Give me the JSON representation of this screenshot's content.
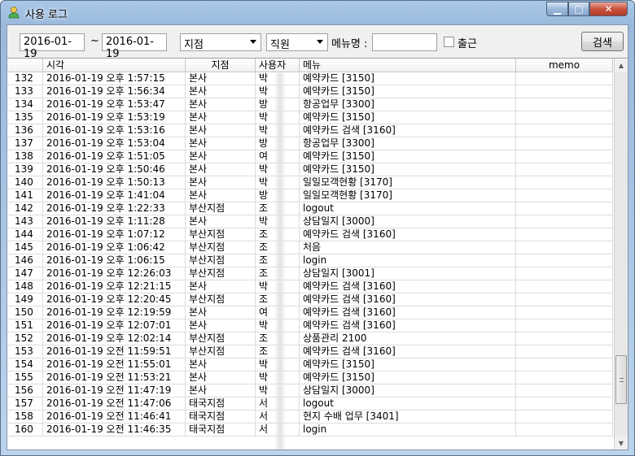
{
  "window": {
    "title": "사용 로그",
    "minimize": "▁",
    "maximize": "□",
    "close": "✕"
  },
  "filters": {
    "date_from": "2016-01-19",
    "separator": "~",
    "date_to": "2016-01-19",
    "branch_select": "지점",
    "staff_select": "직원",
    "menu_label": "메뉴명 :",
    "menu_value": "",
    "checkout_label": "출근",
    "search_button": "검색"
  },
  "table": {
    "headers": [
      "",
      "시각",
      "지점",
      "사용자",
      "메뉴",
      "memo"
    ],
    "rows": [
      [
        "132",
        "2016-01-19 오후 1:57:15",
        "본사",
        "박",
        "예약카드 [3150]",
        ""
      ],
      [
        "133",
        "2016-01-19 오후 1:56:34",
        "본사",
        "박",
        "예약카드 [3150]",
        ""
      ],
      [
        "134",
        "2016-01-19 오후 1:53:47",
        "본사",
        "방",
        "항공업무 [3300]",
        ""
      ],
      [
        "135",
        "2016-01-19 오후 1:53:19",
        "본사",
        "박",
        "예약카드 [3150]",
        ""
      ],
      [
        "136",
        "2016-01-19 오후 1:53:16",
        "본사",
        "박",
        "예약카드 검색 [3160]",
        ""
      ],
      [
        "137",
        "2016-01-19 오후 1:53:04",
        "본사",
        "방",
        "항공업무 [3300]",
        ""
      ],
      [
        "138",
        "2016-01-19 오후 1:51:05",
        "본사",
        "여",
        "예약카드 [3150]",
        ""
      ],
      [
        "139",
        "2016-01-19 오후 1:50:46",
        "본사",
        "박",
        "예약카드 [3150]",
        ""
      ],
      [
        "140",
        "2016-01-19 오후 1:50:13",
        "본사",
        "박",
        "일일모객현황 [3170]",
        ""
      ],
      [
        "141",
        "2016-01-19 오후 1:41:04",
        "본사",
        "방",
        "일일모객현황 [3170]",
        ""
      ],
      [
        "142",
        "2016-01-19 오후 1:22:33",
        "부산지점",
        "조",
        "logout",
        ""
      ],
      [
        "143",
        "2016-01-19 오후 1:11:28",
        "본사",
        "박",
        "상담일지 [3000]",
        ""
      ],
      [
        "144",
        "2016-01-19 오후 1:07:12",
        "부산지점",
        "조",
        "예약카드 검색 [3160]",
        ""
      ],
      [
        "145",
        "2016-01-19 오후 1:06:42",
        "부산지점",
        "조",
        "처음",
        ""
      ],
      [
        "146",
        "2016-01-19 오후 1:06:15",
        "부산지점",
        "조",
        "login",
        ""
      ],
      [
        "147",
        "2016-01-19 오후 12:26:03",
        "부산지점",
        "조",
        "상담일지 [3001]",
        ""
      ],
      [
        "148",
        "2016-01-19 오후 12:21:15",
        "본사",
        "박",
        "예약카드 검색 [3160]",
        ""
      ],
      [
        "149",
        "2016-01-19 오후 12:20:45",
        "부산지점",
        "조",
        "예약카드 검색 [3160]",
        ""
      ],
      [
        "150",
        "2016-01-19 오후 12:19:59",
        "본사",
        "여",
        "예약카드 검색 [3160]",
        ""
      ],
      [
        "151",
        "2016-01-19 오후 12:07:01",
        "본사",
        "박",
        "예약카드 검색 [3160]",
        ""
      ],
      [
        "152",
        "2016-01-19 오후 12:02:14",
        "부산지점",
        "조",
        "상품관리 2100",
        ""
      ],
      [
        "153",
        "2016-01-19 오전 11:59:51",
        "부산지점",
        "조",
        "예약카드 검색 [3160]",
        ""
      ],
      [
        "154",
        "2016-01-19 오전 11:55:01",
        "본사",
        "박",
        "예약카드 [3150]",
        ""
      ],
      [
        "155",
        "2016-01-19 오전 11:53:21",
        "본사",
        "박",
        "예약카드 [3150]",
        ""
      ],
      [
        "156",
        "2016-01-19 오전 11:47:19",
        "본사",
        "박",
        "상담일지 [3000]",
        ""
      ],
      [
        "157",
        "2016-01-19 오전 11:47:06",
        "태국지점",
        "서",
        "logout",
        ""
      ],
      [
        "158",
        "2016-01-19 오전 11:46:41",
        "태국지점",
        "서",
        "현지 수배 업무 [3401]",
        ""
      ],
      [
        "160",
        "2016-01-19 오전 11:46:35",
        "태국지점",
        "서",
        "login",
        ""
      ]
    ]
  },
  "icons": {
    "app": "user-icon",
    "scroll_up": "chevron-up-icon",
    "scroll_down": "chevron-down-icon"
  },
  "colors": {
    "title_gradient": "#a9c8e8",
    "close_button": "#c8523e"
  }
}
